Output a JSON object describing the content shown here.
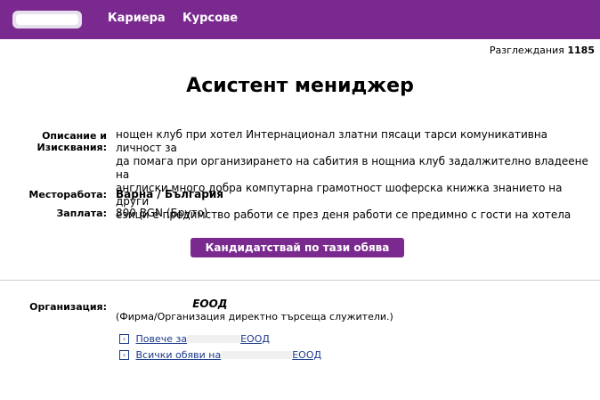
{
  "header": {
    "logo_label": "logo",
    "nav": [
      "Кариера",
      "Курсове"
    ]
  },
  "views": {
    "label": "Разглеждания",
    "count": "1185"
  },
  "job": {
    "title": "Асистент мениджер",
    "description_label_1": "Описание и",
    "description_label_2": "Изисквания:",
    "description_lines": [
      "нощен клуб при хотел Интернационал златни пясаци тарси комуникативна личност за",
      "да помага при организирането на сабития в нощниа клуб задалжително владеене на",
      "англиски много добра компутарна грамотност шоферска книжка знанието на други",
      "езици е предимство работи се през деня работи се предимно с гости на хотела"
    ],
    "location_label": "Месторабота:",
    "location": "Варна / България",
    "salary_label": "Заплата:",
    "salary": "800 BGN (Бруто)",
    "apply_button": "Кандидатствай по тази обява"
  },
  "organization": {
    "label": "Организация:",
    "name_suffix": "ЕООД",
    "description": "(Фирма/Организация директно търсеща служители.)",
    "link_more": "Повече за",
    "link_more_suffix": "ЕООД",
    "link_all": "Всички обяви на",
    "link_all_suffix": "ЕООД"
  }
}
